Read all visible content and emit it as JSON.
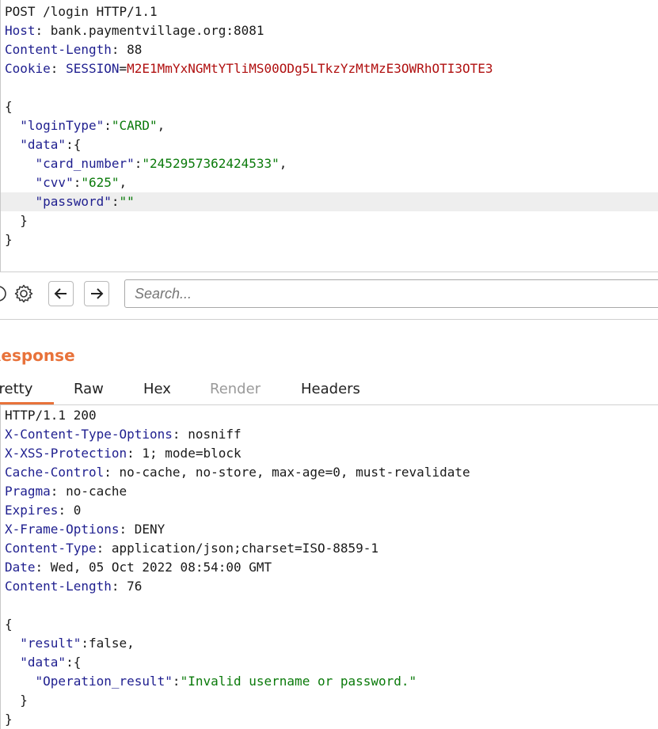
{
  "request": {
    "lines": [
      [
        {
          "t": "POST /login HTTP/1.1",
          "c": "p"
        }
      ],
      [
        {
          "t": "Host",
          "c": "k"
        },
        {
          "t": ": bank.paymentvillage.org:8081",
          "c": "p"
        }
      ],
      [
        {
          "t": "Content-Length",
          "c": "k"
        },
        {
          "t": ": 88",
          "c": "p"
        }
      ],
      [
        {
          "t": "Cookie",
          "c": "k"
        },
        {
          "t": ": ",
          "c": "p"
        },
        {
          "t": "SESSION",
          "c": "k"
        },
        {
          "t": "=",
          "c": "p"
        },
        {
          "t": "M2E1MmYxNGMtYTliMS00ODg5LTkzYzMtMzE3OWRhOTI3OTE3",
          "c": "r"
        }
      ],
      [],
      [
        {
          "t": "{",
          "c": "p"
        }
      ],
      [
        {
          "t": "  ",
          "c": "p"
        },
        {
          "t": "\"loginType\"",
          "c": "b"
        },
        {
          "t": ":",
          "c": "p"
        },
        {
          "t": "\"CARD\"",
          "c": "s"
        },
        {
          "t": ",",
          "c": "p"
        }
      ],
      [
        {
          "t": "  ",
          "c": "p"
        },
        {
          "t": "\"data\"",
          "c": "b"
        },
        {
          "t": ":{",
          "c": "p"
        }
      ],
      [
        {
          "t": "    ",
          "c": "p"
        },
        {
          "t": "\"card_number\"",
          "c": "b"
        },
        {
          "t": ":",
          "c": "p"
        },
        {
          "t": "\"2452957362424533\"",
          "c": "s"
        },
        {
          "t": ",",
          "c": "p"
        }
      ],
      [
        {
          "t": "    ",
          "c": "p"
        },
        {
          "t": "\"cvv\"",
          "c": "b"
        },
        {
          "t": ":",
          "c": "p"
        },
        {
          "t": "\"625\"",
          "c": "s"
        },
        {
          "t": ",",
          "c": "p"
        }
      ],
      [
        {
          "t": "    ",
          "c": "p"
        },
        {
          "t": "\"password\"",
          "c": "b"
        },
        {
          "t": ":",
          "c": "p"
        },
        {
          "t": "\"\"",
          "c": "s"
        }
      ],
      [
        {
          "t": "  }",
          "c": "p"
        }
      ],
      [
        {
          "t": "}",
          "c": "p"
        }
      ]
    ],
    "highlighted_line": 10
  },
  "toolbar": {
    "help_icon": "help-icon",
    "settings_icon": "gear-icon",
    "back_icon": "arrow-left-icon",
    "forward_icon": "arrow-right-icon",
    "search_placeholder": "Search..."
  },
  "response": {
    "title": "Response",
    "tabs": [
      {
        "label": "Pretty",
        "active": true,
        "disabled": false
      },
      {
        "label": "Raw",
        "active": false,
        "disabled": false
      },
      {
        "label": "Hex",
        "active": false,
        "disabled": false
      },
      {
        "label": "Render",
        "active": false,
        "disabled": true
      },
      {
        "label": "Headers",
        "active": false,
        "disabled": false
      }
    ],
    "lines": [
      [
        {
          "t": "HTTP/1.1 200",
          "c": "p"
        }
      ],
      [
        {
          "t": "X-Content-Type-Options",
          "c": "k"
        },
        {
          "t": ": nosniff",
          "c": "p"
        }
      ],
      [
        {
          "t": "X-XSS-Protection",
          "c": "k"
        },
        {
          "t": ": 1; mode=block",
          "c": "p"
        }
      ],
      [
        {
          "t": "Cache-Control",
          "c": "k"
        },
        {
          "t": ": no-cache, no-store, max-age=0, must-revalidate",
          "c": "p"
        }
      ],
      [
        {
          "t": "Pragma",
          "c": "k"
        },
        {
          "t": ": no-cache",
          "c": "p"
        }
      ],
      [
        {
          "t": "Expires",
          "c": "k"
        },
        {
          "t": ": 0",
          "c": "p"
        }
      ],
      [
        {
          "t": "X-Frame-Options",
          "c": "k"
        },
        {
          "t": ": DENY",
          "c": "p"
        }
      ],
      [
        {
          "t": "Content-Type",
          "c": "k"
        },
        {
          "t": ": application/json;charset=ISO-8859-1",
          "c": "p"
        }
      ],
      [
        {
          "t": "Date",
          "c": "k"
        },
        {
          "t": ": Wed, 05 Oct 2022 08:54:00 GMT",
          "c": "p"
        }
      ],
      [
        {
          "t": "Content-Length",
          "c": "k"
        },
        {
          "t": ": 76",
          "c": "p"
        }
      ],
      [],
      [
        {
          "t": "{",
          "c": "p"
        }
      ],
      [
        {
          "t": "  ",
          "c": "p"
        },
        {
          "t": "\"result\"",
          "c": "b"
        },
        {
          "t": ":false,",
          "c": "p"
        }
      ],
      [
        {
          "t": "  ",
          "c": "p"
        },
        {
          "t": "\"data\"",
          "c": "b"
        },
        {
          "t": ":{",
          "c": "p"
        }
      ],
      [
        {
          "t": "    ",
          "c": "p"
        },
        {
          "t": "\"Operation_result\"",
          "c": "b"
        },
        {
          "t": ":",
          "c": "p"
        },
        {
          "t": "\"Invalid username or password.\"",
          "c": "s"
        }
      ],
      [
        {
          "t": "  }",
          "c": "p"
        }
      ],
      [
        {
          "t": "}",
          "c": "p"
        }
      ]
    ]
  },
  "colors": {
    "accent": "#e8723a",
    "key": "#1f1f8f",
    "string": "#0a7a0a",
    "cookie_value": "#b01010"
  }
}
